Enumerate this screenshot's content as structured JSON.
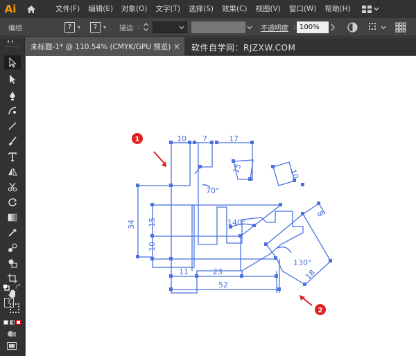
{
  "app": {
    "logo": "Ai"
  },
  "menu": [
    "文件(F)",
    "编辑(E)",
    "对象(O)",
    "文字(T)",
    "选择(S)",
    "效果(C)",
    "视图(V)",
    "窗口(W)",
    "帮助(H)"
  ],
  "control": {
    "selection_label": "编组",
    "fill_symbol": "?",
    "stroke_symbol": "?",
    "stroke_label": "描边",
    "opacity_label": "不透明度",
    "opacity_value": "100%"
  },
  "tab": {
    "title": "未标题-1* @ 110.54% (CMYK/GPU 预览)",
    "close": "×"
  },
  "watermark": "软件自学网：RJZXW.COM",
  "drawing": {
    "dims": [
      "10",
      "7",
      "17",
      "15",
      "10",
      "70°",
      "34",
      "15",
      "140°",
      "10",
      "11",
      "23",
      "52",
      "8",
      "130°",
      "18"
    ],
    "markers": [
      "1",
      "2"
    ],
    "accent_color": "#4a72e0",
    "marker_color": "#e02020"
  }
}
